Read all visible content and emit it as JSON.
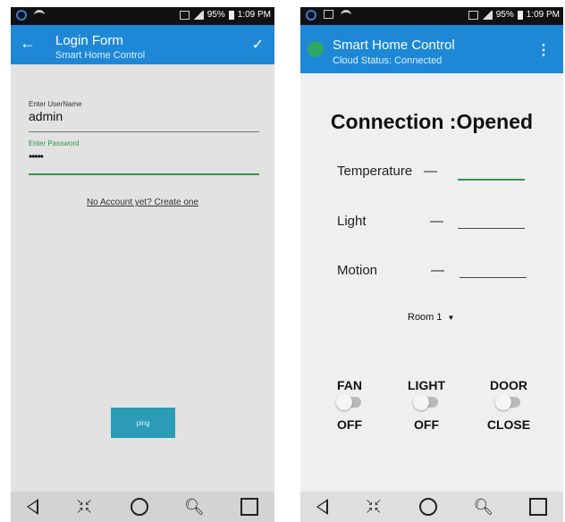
{
  "left_phone": {
    "status": {
      "battery": "95%",
      "time": "1:09 PM"
    },
    "appbar": {
      "title": "Login Form",
      "subtitle": "Smart Home Control"
    },
    "username": {
      "label": "Enter UserName",
      "value": "admin"
    },
    "password": {
      "label": "Enter Password",
      "value": "•••••"
    },
    "create_account_link": "No Account yet? Create one",
    "ping_button": "ping"
  },
  "right_phone": {
    "status": {
      "battery": "95%",
      "time": "1:09 PM"
    },
    "appbar": {
      "title": "Smart Home Control",
      "subtitle": "Cloud Status: Connected",
      "menu_icon": "⋮"
    },
    "connection_status": "Connection :Opened",
    "sensors": [
      {
        "label": "Temperature",
        "dash": "—",
        "value": ""
      },
      {
        "label": "Light",
        "dash": "—",
        "value": ""
      },
      {
        "label": "Motion",
        "dash": "—",
        "value": ""
      }
    ],
    "room_select": {
      "selected": "Room 1"
    },
    "controls": [
      {
        "label": "FAN",
        "state": "OFF"
      },
      {
        "label": "LIGHT",
        "state": "OFF"
      },
      {
        "label": "DOOR",
        "state": "CLOSE"
      }
    ]
  },
  "navbar_icons": [
    "back-triangle",
    "compress-icon",
    "home-circle",
    "search-icon",
    "recent-square"
  ],
  "colors": {
    "accent": "#1e88d6",
    "ping_button": "#2c9bb5",
    "logo": "#2fa765"
  }
}
